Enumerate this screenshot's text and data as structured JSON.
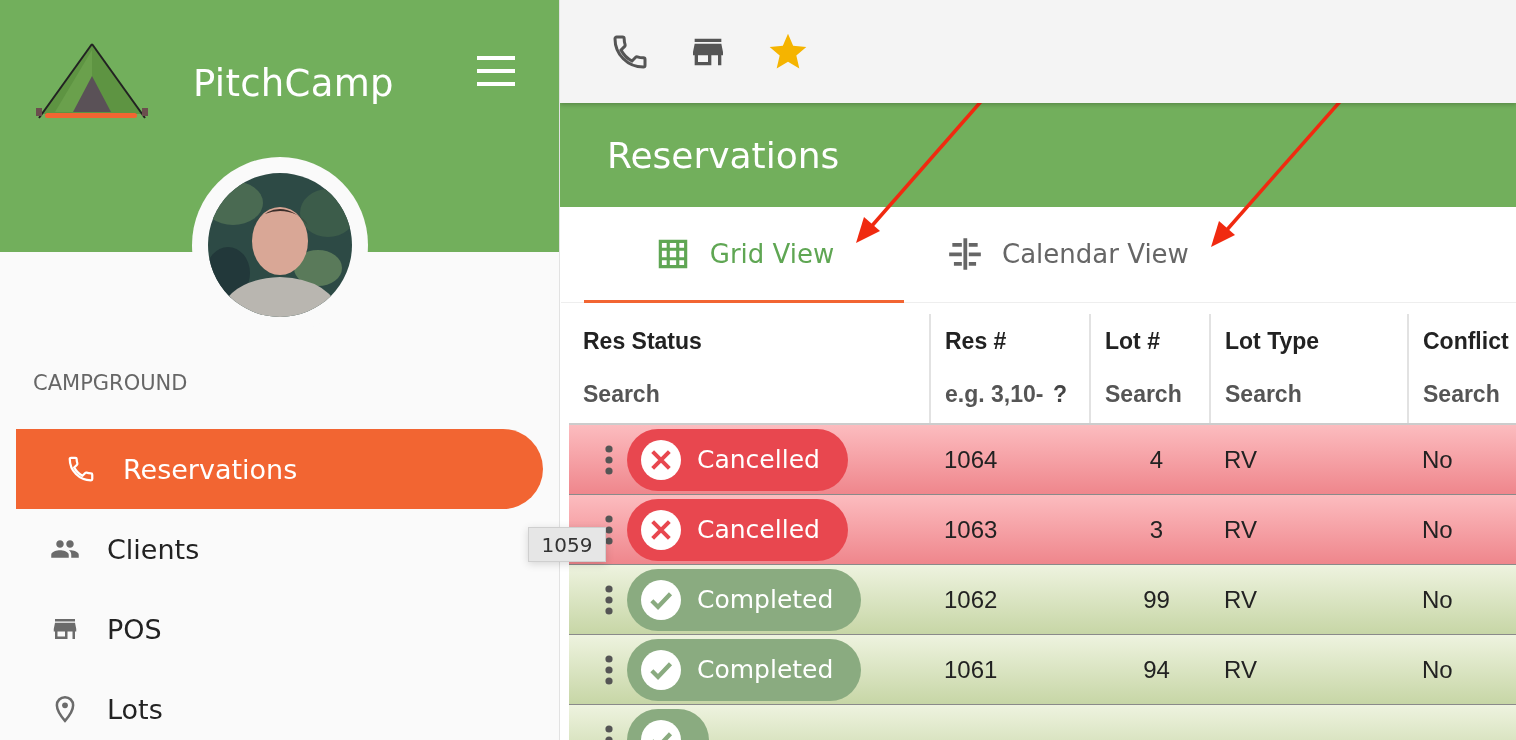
{
  "app": {
    "name": "PitchCamp"
  },
  "sidebar": {
    "section_label": "CAMPGROUND",
    "items": [
      {
        "label": "Reservations",
        "selected": true
      },
      {
        "label": "Clients",
        "selected": false
      },
      {
        "label": "POS",
        "selected": false
      },
      {
        "label": "Lots",
        "selected": false
      }
    ]
  },
  "page": {
    "title": "Reservations"
  },
  "tabs": [
    {
      "label": "Grid View",
      "selected": true
    },
    {
      "label": "Calendar View",
      "selected": false
    }
  ],
  "table": {
    "columns": [
      {
        "label": "Res Status",
        "placeholder": "Search"
      },
      {
        "label": "Res #",
        "placeholder": "e.g. 3,10-",
        "help": "?"
      },
      {
        "label": "Lot #",
        "placeholder": "Search"
      },
      {
        "label": "Lot Type",
        "placeholder": "Search"
      },
      {
        "label": "Conflict",
        "placeholder": "Search"
      }
    ],
    "rows": [
      {
        "status": {
          "label": "Cancelled",
          "kind": "cancelled"
        },
        "res": "1064",
        "lot": "4",
        "lot_type": "RV",
        "conflicts": "No"
      },
      {
        "status": {
          "label": "Cancelled",
          "kind": "cancelled"
        },
        "res": "1063",
        "lot": "3",
        "lot_type": "RV",
        "conflicts": "No"
      },
      {
        "status": {
          "label": "Completed",
          "kind": "completed"
        },
        "res": "1062",
        "lot": "99",
        "lot_type": "RV",
        "conflicts": "No"
      },
      {
        "status": {
          "label": "Completed",
          "kind": "completed"
        },
        "res": "1061",
        "lot": "94",
        "lot_type": "RV",
        "conflicts": "No"
      },
      {
        "status": {
          "kind": "completed"
        }
      }
    ]
  },
  "tooltip": {
    "text": "1059"
  }
}
